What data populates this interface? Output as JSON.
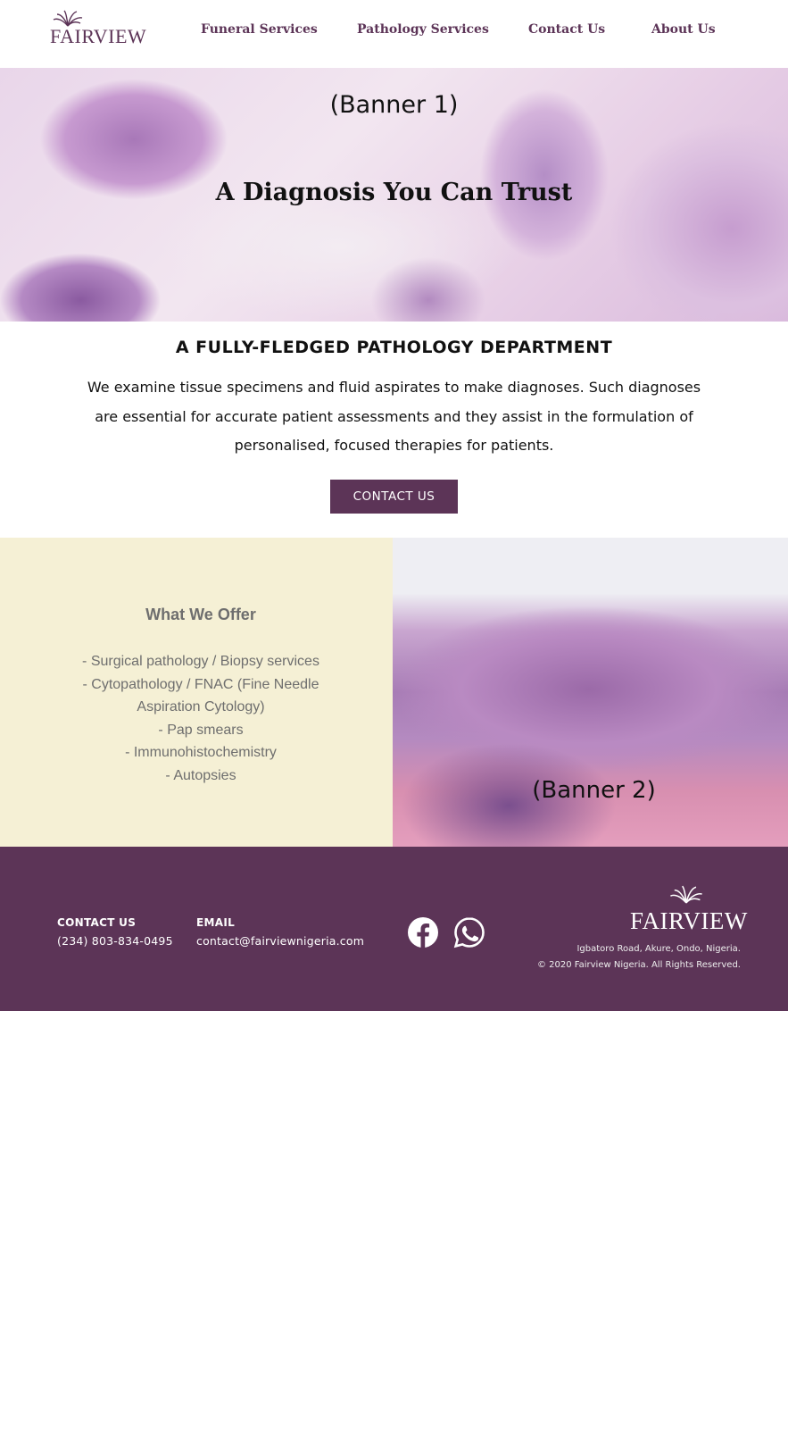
{
  "header": {
    "logo_text": "FAIRVIEW",
    "logo_icon": "fairview-flower-icon",
    "nav": [
      {
        "label": "Funeral Services"
      },
      {
        "label": "Pathology Services"
      },
      {
        "label": "Contact Us"
      },
      {
        "label": "About Us"
      }
    ]
  },
  "banner1": {
    "label": "(Banner 1)",
    "title": "A Diagnosis You Can Trust"
  },
  "intro": {
    "title": "A FULLY-FLEDGED PATHOLOGY DEPARTMENT",
    "text": "We examine tissue specimens and fluid aspirates to make diagnoses. Such diagnoses are essential for accurate patient assessments and they assist in the formulation of personalised, focused therapies for patients.",
    "cta_label": "CONTACT US"
  },
  "offer": {
    "title": "What We Offer",
    "items": [
      "- Surgical pathology / Biopsy services",
      "- Cytopathology / FNAC (Fine Needle Aspiration Cytology)",
      "- Pap smears",
      "- Immunohistochemistry",
      "- Autopsies"
    ]
  },
  "banner2": {
    "label": "(Banner 2)"
  },
  "footer": {
    "contact_heading": "CONTACT US",
    "phone": "(234) 803-834-0495",
    "email_heading": "EMAIL",
    "email": "contact@fairviewnigeria.com",
    "social_icons": [
      "facebook-icon",
      "whatsapp-icon"
    ],
    "logo_text": "FAIRVIEW",
    "address": "Igbatoro Road, Akure, Ondo, Nigeria.",
    "copyright": "© 2020 Fairview Nigeria. All Rights Reserved."
  },
  "colors": {
    "brand_purple": "#5c3457",
    "offer_bg": "#f5f0d5",
    "offer_text": "#6e6e6e"
  }
}
